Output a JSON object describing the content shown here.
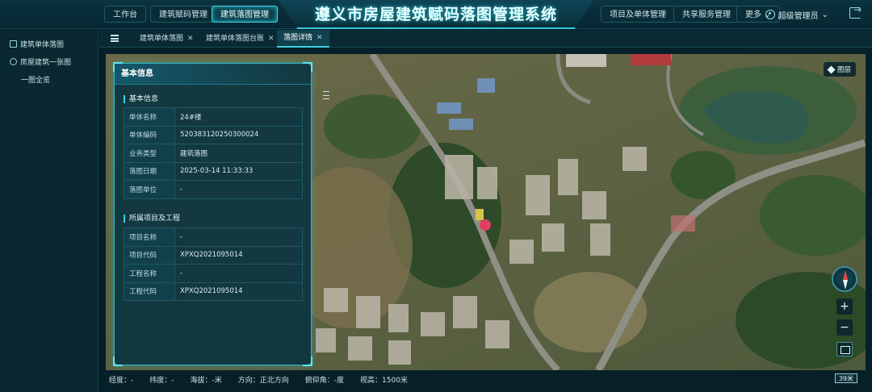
{
  "header": {
    "title": "遵义市房屋建筑赋码落图管理系统",
    "nav_left": [
      "工作台",
      "建筑赋码管理",
      "建筑落图管理"
    ],
    "nav_right": [
      "项目及单体管理",
      "共享服务管理",
      "更多"
    ],
    "user_name": "超级管理员",
    "active_nav": "建筑落图管理"
  },
  "sidebar": {
    "items": [
      {
        "label": "建筑单体落图",
        "icon": "building-icon"
      },
      {
        "label": "房屋建筑一张图",
        "icon": "globe-icon"
      },
      {
        "label": "一图全览",
        "icon": ""
      }
    ]
  },
  "tabs": [
    {
      "label": "建筑单体落图",
      "active": false
    },
    {
      "label": "建筑单体落图台账",
      "active": false
    },
    {
      "label": "落图详情",
      "active": true
    }
  ],
  "panel": {
    "title": "基本信息",
    "section1_title": "基本信息",
    "section1_rows": [
      {
        "k": "单体名称",
        "v": "24#楼"
      },
      {
        "k": "单体编码",
        "v": "520383120250300024"
      },
      {
        "k": "业务类型",
        "v": "建筑落图"
      },
      {
        "k": "落图日期",
        "v": "2025-03-14 11:33:33"
      },
      {
        "k": "落图单位",
        "v": "-"
      }
    ],
    "section2_title": "所属项目及工程",
    "section2_rows": [
      {
        "k": "项目名称",
        "v": "-"
      },
      {
        "k": "项目代码",
        "v": "XPXQ2021095014"
      },
      {
        "k": "工程名称",
        "v": "-"
      },
      {
        "k": "工程代码",
        "v": "XPXQ2021095014"
      }
    ]
  },
  "map": {
    "layer_button": "图层",
    "zoom_in": "+",
    "zoom_out": "−"
  },
  "status": {
    "longitude": "经度：-",
    "latitude": "纬度：-",
    "altitude": "海拔：-米",
    "direction": "方向：正北方向",
    "pitch": "俯仰角：-度",
    "view_height": "视高：1500米",
    "scale": "39米"
  },
  "colors": {
    "accent": "#3fd2e0",
    "background": "#06202a",
    "panel": "#0c3440"
  }
}
